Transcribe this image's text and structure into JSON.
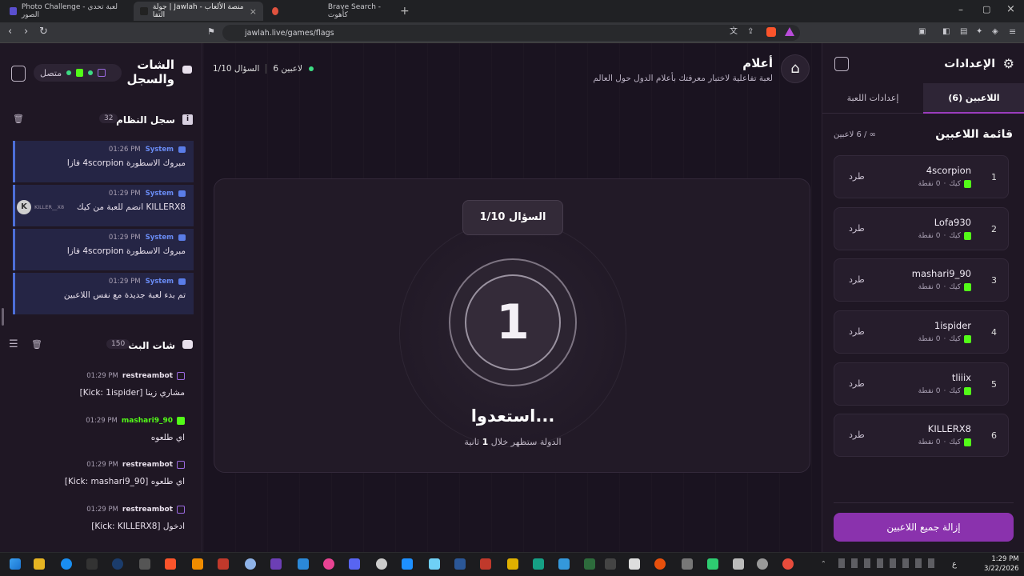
{
  "browser": {
    "tabs": [
      {
        "label": "Photo Challenge - لعبة تحدي الصور",
        "active": false
      },
      {
        "label": "جولة | Jawlah - منصة الألعاب التفا",
        "active": true
      },
      {
        "label": "Brave Search - كأهوت",
        "active": false
      }
    ],
    "url": "jawlah.live/games/flags"
  },
  "left_panel": {
    "title_line1": "الشات",
    "title_line2": "والسجل",
    "status": "متصل",
    "system_log": {
      "title": "سجل النظام",
      "count": "32",
      "messages": [
        {
          "sender": "System",
          "time": "01:26 PM",
          "text": "مبروك الاسطورة 4scorpion فازا"
        },
        {
          "sender": "System",
          "time": "01:29 PM",
          "text": "KILLERX8 انضم للعبة من كيك",
          "avatar_name": "KILLER__X8"
        },
        {
          "sender": "System",
          "time": "01:29 PM",
          "text": "مبروك الاسطورة 4scorpion فازا"
        },
        {
          "sender": "System",
          "time": "01:29 PM",
          "text": "تم بدء لعبة جديدة مع نفس اللاعبين"
        }
      ]
    },
    "stream_chat": {
      "title": "شات البث",
      "count": "150",
      "messages": [
        {
          "user": "restreambot",
          "time": "01:29 PM",
          "text": "[Kick: 1ispider] مشاري زينا",
          "platform": "restream"
        },
        {
          "user": "mashari9_90",
          "time": "01:29 PM",
          "text": "اي طلعوه",
          "platform": "kick"
        },
        {
          "user": "restreambot",
          "time": "01:29 PM",
          "text": "[Kick: mashari9_90] اي طلعوه",
          "platform": "restream"
        },
        {
          "user": "restreambot",
          "time": "01:29 PM",
          "text": "[Kick: KILLERX8] ادخول",
          "platform": "restream"
        }
      ]
    }
  },
  "main": {
    "game_title": "أعلام",
    "game_subtitle": "لعبة تفاعلية لاختبار معرفتك بأعلام الدول حول العالم",
    "players_label": "6 لاعبين",
    "question_label": "السؤال 1/10",
    "card_question": "السؤال 1/10",
    "countdown": "1",
    "ready_text": "استعدوا...",
    "hint_prefix": "الدولة ستظهر خلال",
    "hint_number": "1",
    "hint_suffix": "ثانية"
  },
  "right_panel": {
    "title": "الإعدادات",
    "tabs": {
      "players": "اللاعبين (6)",
      "game_settings": "إعدادات اللعبة"
    },
    "list_title": "قائمة اللاعبين",
    "list_count": "∞ / 6 لاعبين",
    "kick_label": "طرد",
    "players": [
      {
        "rank": "1",
        "name": "4scorpion",
        "platform": "كيك",
        "points": "0 نقطة"
      },
      {
        "rank": "2",
        "name": "Lofa930",
        "platform": "كيك",
        "points": "0 نقطة"
      },
      {
        "rank": "3",
        "name": "mashari9_90",
        "platform": "كيك",
        "points": "0 نقطة"
      },
      {
        "rank": "4",
        "name": "1ispider",
        "platform": "كيك",
        "points": "0 نقطة"
      },
      {
        "rank": "5",
        "name": "tliiix",
        "platform": "كيك",
        "points": "0 نقطة"
      },
      {
        "rank": "6",
        "name": "KILLERX8",
        "platform": "كيك",
        "points": "0 نقطة"
      }
    ],
    "remove_all": "إزالة جميع اللاعبين"
  },
  "taskbar": {
    "time": "1:29 PM",
    "date": "3/22/2026",
    "lang": "ع"
  },
  "colors": {
    "accent_purple": "#9b3dbd",
    "kick_green": "#53fc18",
    "system_blue": "#4d6fd8",
    "status_green": "#3ddc84"
  }
}
